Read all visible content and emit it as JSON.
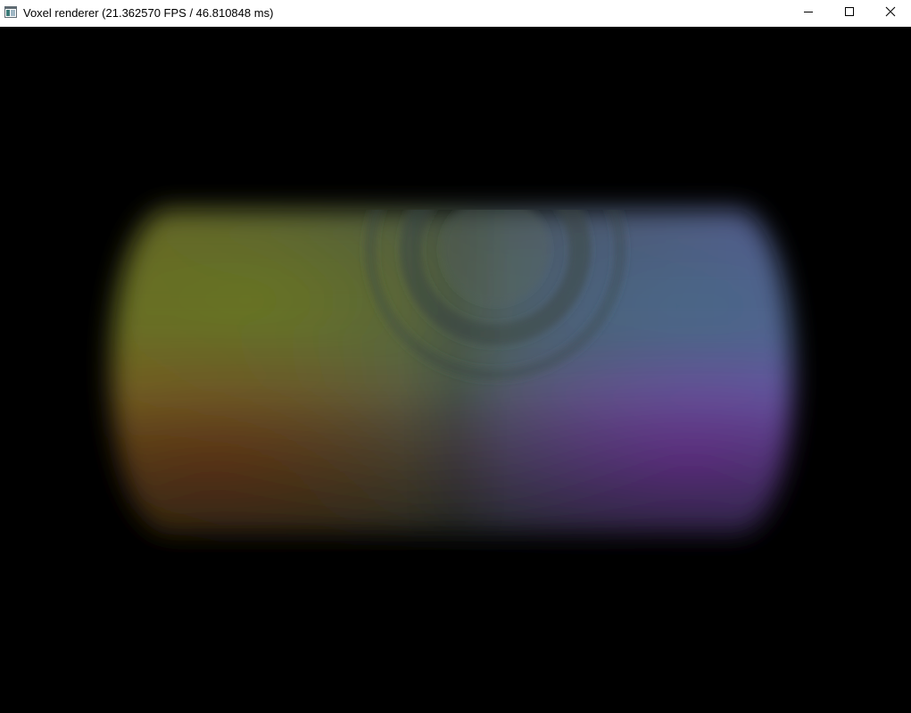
{
  "window": {
    "title": "Voxel renderer (21.362570 FPS / 46.810848 ms)",
    "icon": "app-window-icon",
    "controls": {
      "minimize_icon": "minimize-icon",
      "maximize_icon": "maximize-icon",
      "close_icon": "close-icon"
    }
  },
  "render": {
    "background": "#000000",
    "colors": {
      "top_left": "#6f7d22",
      "top_right": "#4c6f8f",
      "bottom_left": "#7a3f18",
      "bottom_right": "#7b3aa8",
      "center": "#4f5f55"
    }
  }
}
